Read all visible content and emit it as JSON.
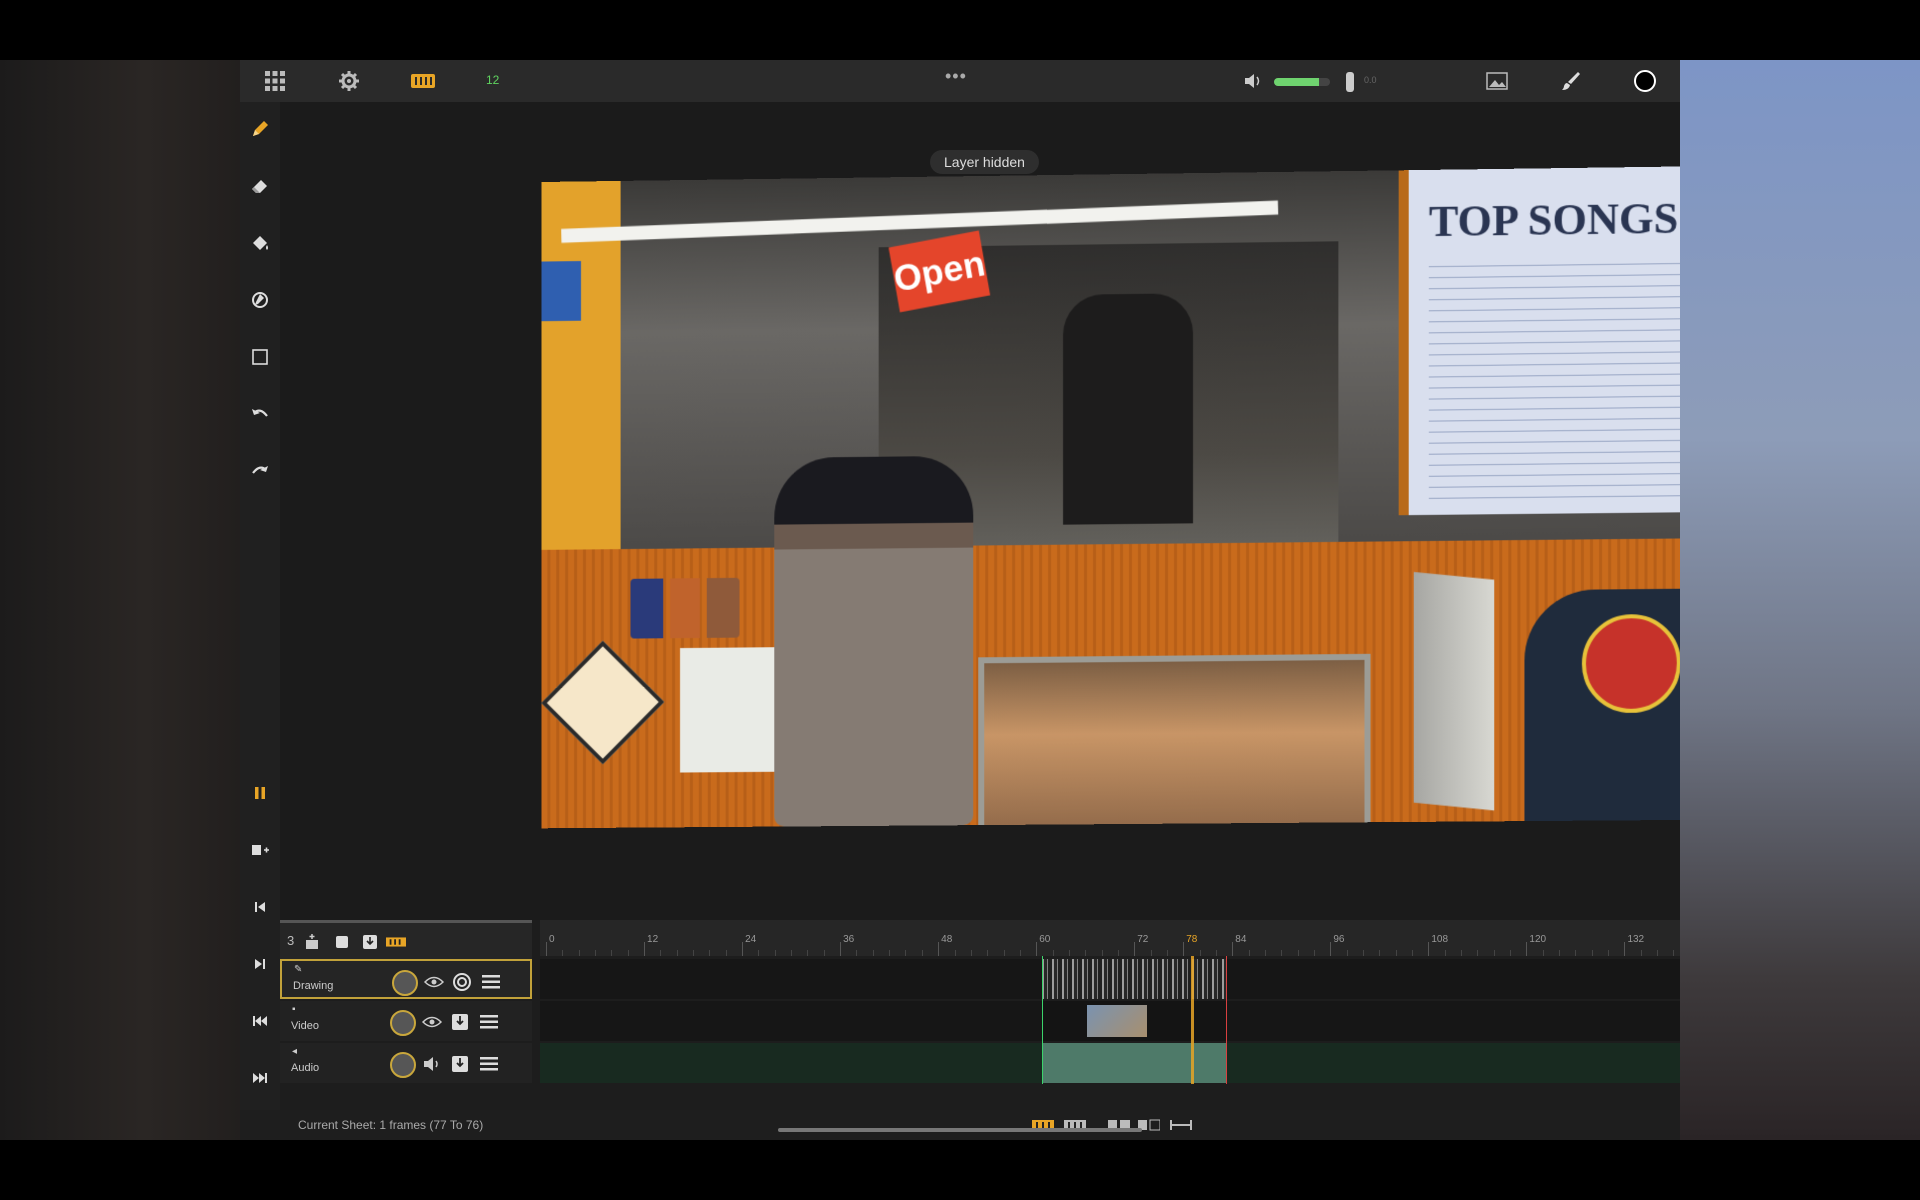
{
  "topbar": {
    "fps": "12",
    "volume_value": "0.0",
    "volume_level": 0.8,
    "icons": [
      "grid-icon",
      "gear-icon",
      "filmstrip-icon",
      "more-icon",
      "speaker-icon",
      "image-icon",
      "brush-icon",
      "color-circle-icon"
    ]
  },
  "toast": "Layer hidden",
  "photo": {
    "menu_title": "TOP SONGS",
    "sign_open": "Open"
  },
  "timeline": {
    "layer_count": "3",
    "ruler_ticks": [
      "0",
      "12",
      "24",
      "36",
      "48",
      "60",
      "72",
      "78",
      "84",
      "96",
      "108",
      "120",
      "132"
    ],
    "playhead": "78",
    "layers": [
      {
        "name": "Drawing",
        "icon": "pencil-icon"
      },
      {
        "name": "Video",
        "icon": "lock-icon"
      },
      {
        "name": "Audio",
        "icon": "speaker-small-icon"
      }
    ]
  },
  "footer": {
    "status": "Current Sheet: 1 frames (77 To 76)"
  },
  "colors": {
    "accent": "#e8a526",
    "fps_green": "#5fd35f",
    "in_marker": "#3bd36b",
    "out_marker": "#d94040"
  }
}
